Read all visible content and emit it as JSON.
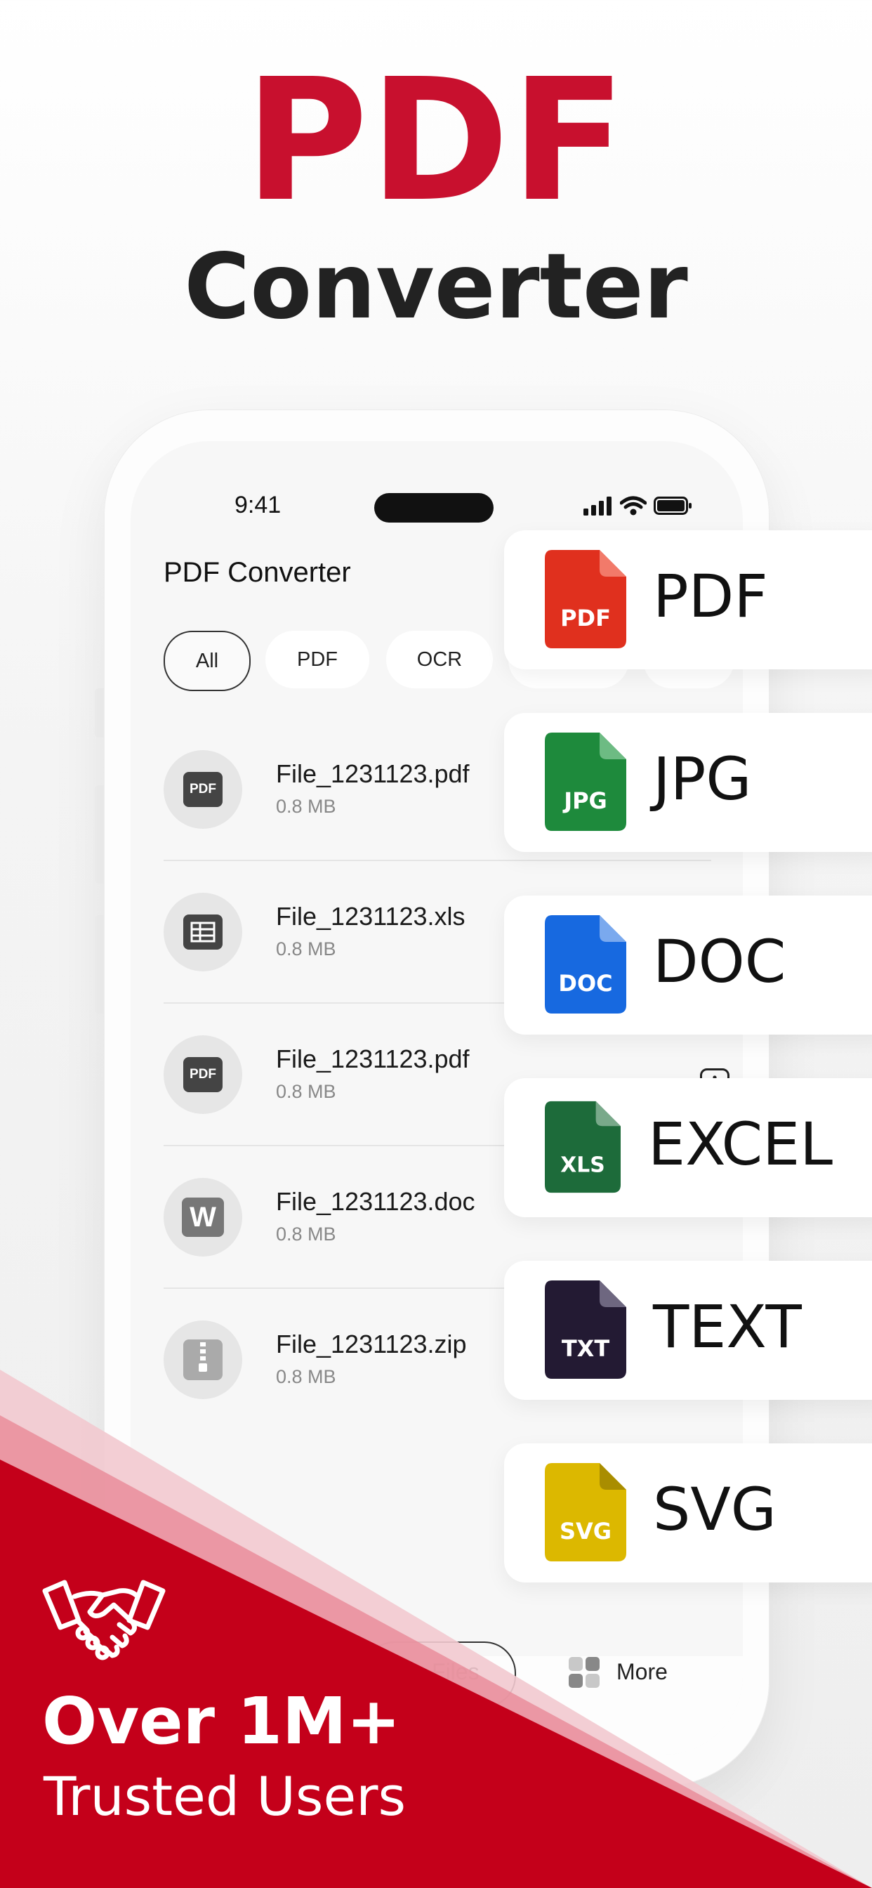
{
  "hero": {
    "title": "PDF",
    "subtitle": "Converter"
  },
  "status": {
    "time": "9:41"
  },
  "app": {
    "title": "PDF Converter"
  },
  "chips": [
    {
      "label": "All",
      "active": true
    },
    {
      "label": "PDF",
      "active": false
    },
    {
      "label": "OCR",
      "active": false
    }
  ],
  "files": [
    {
      "name": "File_1231123.pdf",
      "size": "0.8 MB",
      "icon": "pdf-icon",
      "icon_text": "PDF"
    },
    {
      "name": "File_1231123.xls",
      "size": "0.8 MB",
      "icon": "spreadsheet-icon",
      "icon_text": ""
    },
    {
      "name": "File_1231123.pdf",
      "size": "0.8 MB",
      "icon": "pdf-icon",
      "icon_text": "PDF"
    },
    {
      "name": "File_1231123.doc",
      "size": "0.8 MB",
      "icon": "word-icon",
      "icon_text": "W"
    },
    {
      "name": "File_1231123.zip",
      "size": "0.8 MB",
      "icon": "zip-icon",
      "icon_text": ""
    }
  ],
  "nav": {
    "files_label": "Files",
    "more_label": "More"
  },
  "formats": [
    {
      "label": "PDF",
      "badge": "PDF",
      "color": "#e0301e",
      "fold": "#f27a6a"
    },
    {
      "label": "JPG",
      "badge": "JPG",
      "color": "#1e8a3c",
      "fold": "#6dbb83"
    },
    {
      "label": "DOC",
      "badge": "DOC",
      "color": "#1769e0",
      "fold": "#7aa9ee"
    },
    {
      "label": "EXCEL",
      "badge": "XLS",
      "color": "#1d6b3a",
      "fold": "#79a98a"
    },
    {
      "label": "TEXT",
      "badge": "TXT",
      "color": "#231a33",
      "fold": "#6e6780"
    },
    {
      "label": "SVG",
      "badge": "SVG",
      "color": "#dcb800",
      "fold": "#a98d00"
    }
  ],
  "banner": {
    "headline": "Over 1M+",
    "subline": "Trusted Users",
    "color": "#c4001a"
  }
}
